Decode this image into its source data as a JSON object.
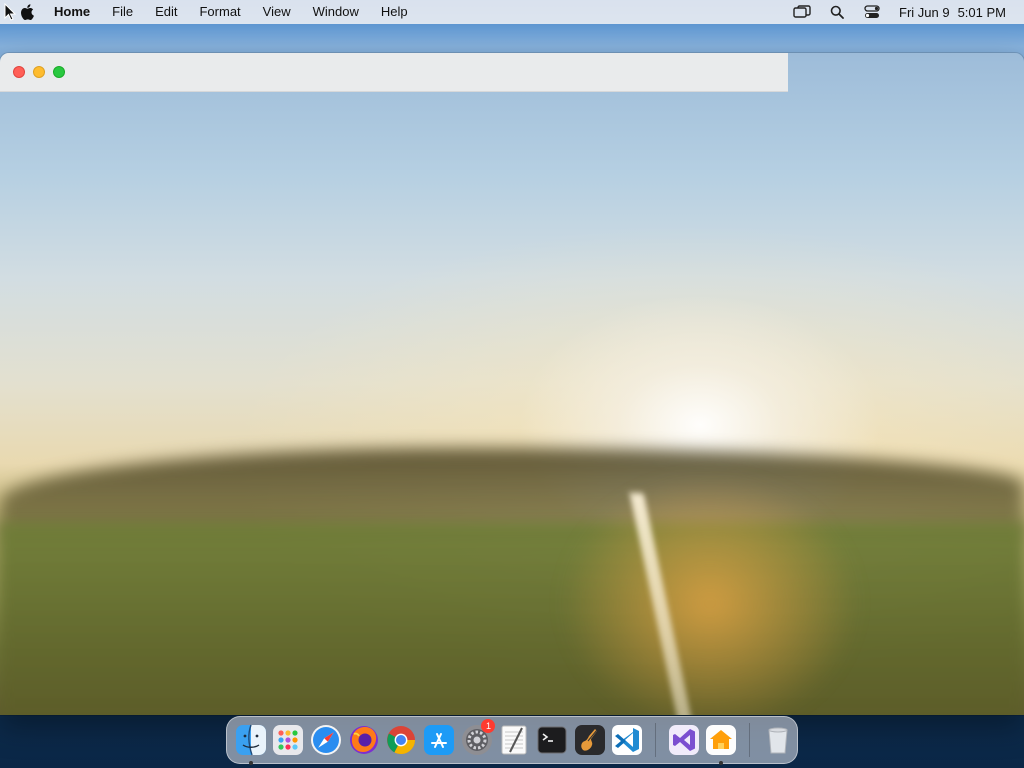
{
  "menubar": {
    "app_name": "Home",
    "items": [
      "File",
      "Edit",
      "Format",
      "View",
      "Window",
      "Help"
    ],
    "clock": {
      "date": "Fri Jun 9",
      "time": "5:01 PM"
    }
  },
  "window": {
    "title": ""
  },
  "dock": {
    "items": [
      {
        "name": "finder-icon",
        "running": true
      },
      {
        "name": "launchpad-icon",
        "running": false
      },
      {
        "name": "safari-icon",
        "running": false
      },
      {
        "name": "firefox-icon",
        "running": false
      },
      {
        "name": "chrome-icon",
        "running": false
      },
      {
        "name": "app-store-icon",
        "running": false
      },
      {
        "name": "system-settings-icon",
        "running": false,
        "badge": "1"
      },
      {
        "name": "textedit-icon",
        "running": false
      },
      {
        "name": "terminal-icon",
        "running": false
      },
      {
        "name": "garageband-icon",
        "running": false
      },
      {
        "name": "vscode-icon",
        "running": false
      },
      {
        "name": "visual-studio-icon",
        "running": false
      },
      {
        "name": "home-app-icon",
        "running": true
      },
      {
        "name": "trash-icon",
        "running": false
      }
    ]
  },
  "colors": {
    "close": "#ff5f57",
    "minimize": "#febc2e",
    "maximize": "#28c840"
  }
}
